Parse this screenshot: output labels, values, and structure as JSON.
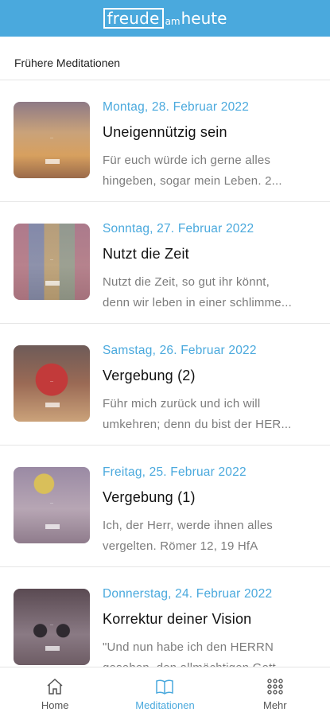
{
  "header": {
    "logo_part1": "freude",
    "logo_part2": "am",
    "logo_part3": "heute"
  },
  "section_title": "Frühere Meditationen",
  "items": [
    {
      "date": "Montag, 28. Februar 2022",
      "title": "Uneigennützig sein",
      "excerpt_line1": "Für euch würde ich gerne alles",
      "excerpt_line2": "hingeben, sogar mein Leben. 2...",
      "thumb_icon": "desert-sunset-thumbnail"
    },
    {
      "date": "Sonntag, 27. Februar 2022",
      "title": "Nutzt die Zeit",
      "excerpt_line1": "Nutzt die Zeit, so gut ihr könnt,",
      "excerpt_line2": "denn wir leben in einer schlimme...",
      "thumb_icon": "sticky-notes-thumbnail"
    },
    {
      "date": "Samstag, 26. Februar 2022",
      "title": "Vergebung (2)",
      "excerpt_line1": "Führ mich zurück und ich will",
      "excerpt_line2": "umkehren; denn du bist der HER...",
      "thumb_icon": "heart-hands-thumbnail"
    },
    {
      "date": "Freitag, 25. Februar 2022",
      "title": "Vergebung (1)",
      "excerpt_line1": "Ich, der Herr, werde ihnen alles",
      "excerpt_line2": "vergelten. Römer 12, 19 HfA",
      "thumb_icon": "trophy-thumbnail"
    },
    {
      "date": "Donnerstag, 24. Februar 2022",
      "title": "Korrektur deiner Vision",
      "excerpt_line1": "\"Und nun habe ich den HERRN",
      "excerpt_line2": "gesehen, den allmächtigen Gott...",
      "thumb_icon": "binoculars-thumbnail"
    }
  ],
  "tabs": [
    {
      "label": "Home",
      "icon": "home-icon",
      "active": false
    },
    {
      "label": "Meditationen",
      "icon": "book-icon",
      "active": true
    },
    {
      "label": "Mehr",
      "icon": "grid-icon",
      "active": false
    }
  ],
  "colors": {
    "accent": "#4aa9dd",
    "text_muted": "#7c7c7c"
  }
}
